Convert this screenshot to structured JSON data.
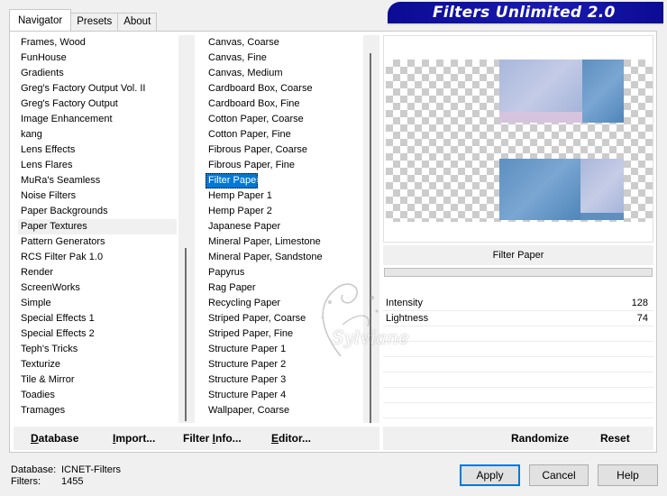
{
  "tabs": [
    {
      "label": "Navigator"
    },
    {
      "label": "Presets"
    },
    {
      "label": "About"
    }
  ],
  "banner": {
    "title": "Filters Unlimited 2.0"
  },
  "categories": [
    "Frames, Wood",
    "FunHouse",
    "Gradients",
    "Greg's Factory Output Vol. II",
    "Greg's Factory Output",
    "Image Enhancement",
    "kang",
    "Lens Effects",
    "Lens Flares",
    "MuRa's Seamless",
    "Noise Filters",
    "Paper Backgrounds",
    "Paper Textures",
    "Pattern Generators",
    "RCS Filter Pak 1.0",
    "Render",
    "ScreenWorks",
    "Simple",
    "Special Effects 1",
    "Special Effects 2",
    "Teph's Tricks",
    "Texturize",
    "Tile & Mirror",
    "Toadies",
    "Tramages"
  ],
  "filters": [
    "Canvas, Coarse",
    "Canvas, Fine",
    "Canvas, Medium",
    "Cardboard Box, Coarse",
    "Cardboard Box, Fine",
    "Cotton Paper, Coarse",
    "Cotton Paper, Fine",
    "Fibrous Paper, Coarse",
    "Fibrous Paper, Fine",
    "Filter Paper",
    "Hemp Paper 1",
    "Hemp Paper 2",
    "Japanese Paper",
    "Mineral Paper, Limestone",
    "Mineral Paper, Sandstone",
    "Papyrus",
    "Rag Paper",
    "Recycling Paper",
    "Striped Paper, Coarse",
    "Striped Paper, Fine",
    "Structure Paper 1",
    "Structure Paper 2",
    "Structure Paper 3",
    "Structure Paper 4",
    "Wallpaper, Coarse"
  ],
  "buttons": {
    "database": {
      "u": "D",
      "rest": "atabase"
    },
    "import": {
      "u": "I",
      "rest": "mport..."
    },
    "filter_info": {
      "pre": "Filter ",
      "u": "I",
      "rest": "nfo..."
    },
    "editor": {
      "u": "E",
      "rest": "ditor..."
    },
    "randomize": "Randomize",
    "reset": "Reset",
    "apply": "Apply",
    "cancel": "Cancel",
    "help": "Help"
  },
  "preview": {
    "filter_name": "Filter Paper"
  },
  "params": [
    {
      "label": "Intensity",
      "value": "128"
    },
    {
      "label": "Lightness",
      "value": "74"
    }
  ],
  "watermark": "Sylviane",
  "status": {
    "database_label": "Database:",
    "database_value": "ICNET-Filters",
    "filters_label": "Filters:",
    "filters_value": "1455"
  }
}
